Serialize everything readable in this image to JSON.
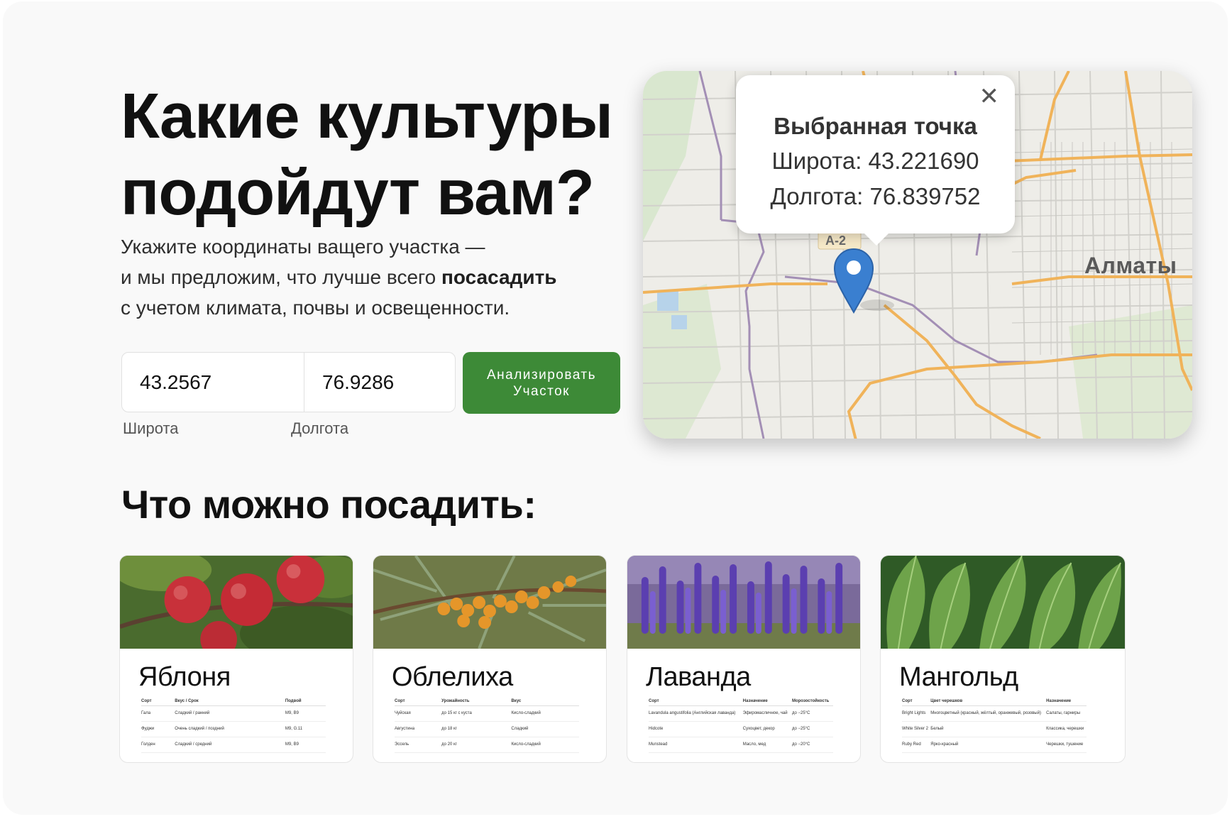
{
  "hero": {
    "title": "Какие культуры\nподойдут вам?",
    "subtitle_before": "Укажите координаты ващего участка —\nи мы предложим, что лучше всего ",
    "subtitle_bold": "посасадить",
    "subtitle_after": "\nс учетом климата, почвы и освещенности."
  },
  "form": {
    "latitude_value": "43.2567",
    "longitude_value": "76.9286",
    "latitude_label": "Широта",
    "longitude_label": "Долгота",
    "analyze_button": "Анализировать\nУчасток",
    "accent_color": "#3d8a37"
  },
  "map": {
    "city_label": "Алматы",
    "road_label": "А-2",
    "popup": {
      "title": "Выбранная точка",
      "latitude": "Широта: 43.221690",
      "longitude": "Долгота: 76.839752",
      "close_icon": "close-icon"
    },
    "marker_icon": "map-pin-icon",
    "marker_color": "#3a7fd0"
  },
  "crops": {
    "title": "Что можно посадить:",
    "items": [
      {
        "name": "Яблоня",
        "photo": "apple-tree-photo",
        "columns": [
          "Сорт",
          "Вкус / Срок",
          "Подвой"
        ],
        "rows": [
          [
            "Гала",
            "Сладкий / ранний",
            "M9, B9"
          ],
          [
            "Фуджи",
            "Очень сладкий / поздний",
            "M9, G.11"
          ],
          [
            "Голден",
            "Сладкий / средний",
            "M9, B9"
          ]
        ]
      },
      {
        "name": "Облелиха",
        "photo": "sea-buckthorn-photo",
        "columns": [
          "Сорт",
          "Урожайность",
          "Вкус"
        ],
        "rows": [
          [
            "Чуйская",
            "до 15 кг с куста",
            "Кисло-сладкий"
          ],
          [
            "Августина",
            "до 18 кг",
            "Сладкий"
          ],
          [
            "Эссель",
            "до 20 кг",
            "Кисло-сладкий"
          ]
        ]
      },
      {
        "name": "Лаванда",
        "photo": "lavender-photo",
        "columns": [
          "Сорт",
          "Назначение",
          "Морозостойкость"
        ],
        "rows": [
          [
            "Lavandula angustifolia (Английская лаванда)",
            "Эфиромасличное, чай",
            "до −25°C"
          ],
          [
            "Hidcote",
            "Сухоцвет, декор",
            "до −25°C"
          ],
          [
            "Munstead",
            "Масло, мед",
            "до −20°C"
          ]
        ]
      },
      {
        "name": "Мангольд",
        "photo": "chard-photo",
        "columns": [
          "Сорт",
          "Цвет черешков",
          "Назначение"
        ],
        "rows": [
          [
            "Bright Lights",
            "Многоцветный (красный, жёлтый, оранжевый, розовый)",
            "Салаты, гарниры"
          ],
          [
            "White Silver 2",
            "Белый",
            "Классика, черешки"
          ],
          [
            "Ruby Red",
            "Ярко-красный",
            "Черешки, тушение"
          ]
        ]
      }
    ]
  }
}
